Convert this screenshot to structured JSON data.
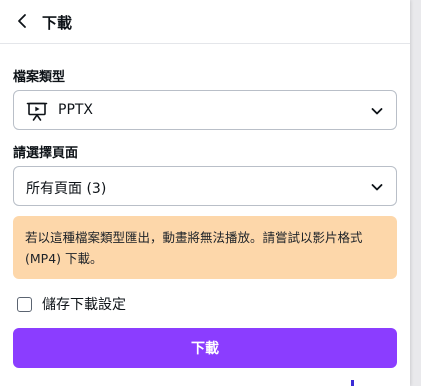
{
  "header": {
    "title": "下載",
    "back_icon": "chevron-left-icon"
  },
  "file_type": {
    "label": "檔案類型",
    "selected": "PPTX",
    "icon": "presentation-icon"
  },
  "pages": {
    "label": "請選擇頁面",
    "selected": "所有頁面 (3)"
  },
  "alert": {
    "message": "若以這種檔案類型匯出，動畫將無法播放。請嘗試以影片格式(MP4) 下載。",
    "background": "#fdd7aa"
  },
  "save_settings": {
    "label": "儲存下載設定",
    "checked": false
  },
  "download_button": {
    "label": "下載",
    "color": "#8b3dff"
  }
}
